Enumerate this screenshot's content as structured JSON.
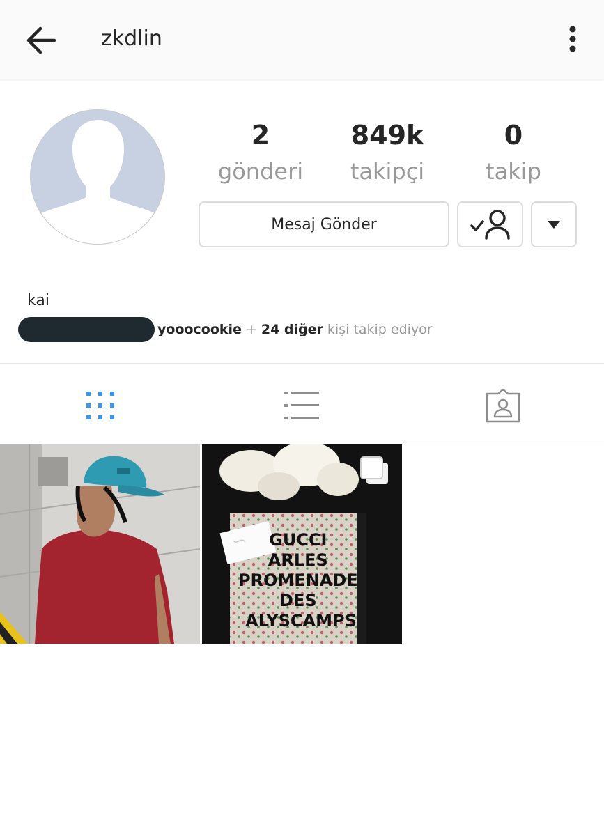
{
  "header": {
    "username": "zkdlin",
    "back_icon": "arrow-left-icon",
    "more_icon": "more-vertical-icon"
  },
  "stats": [
    {
      "value": "2",
      "label": "gönderi"
    },
    {
      "value": "849k",
      "label": "takipçi"
    },
    {
      "value": "0",
      "label": "takip"
    }
  ],
  "actions": {
    "message_label": "Mesaj Gönder",
    "following_icon": "user-check-icon",
    "dropdown_icon": "caret-down-icon"
  },
  "bio": {
    "name": "kai",
    "followed_by_user": "yooocookie",
    "followed_by_plus": "+",
    "followed_by_count": "24 diğer",
    "followed_by_rest": "kişi takip ediyor"
  },
  "tabs": [
    {
      "icon": "grid-icon",
      "active": true
    },
    {
      "icon": "list-icon",
      "active": false
    },
    {
      "icon": "tagged-icon",
      "active": false
    }
  ],
  "posts": [
    {
      "id": "post-1",
      "multi": false
    },
    {
      "id": "post-2",
      "multi": true,
      "caption_lines": [
        "GUCCI",
        "ARLES",
        "PROMENADE",
        "DES",
        "ALYSCAMPS"
      ]
    }
  ],
  "colors": {
    "accent": "#3897f0",
    "muted": "#999999",
    "text": "#262626"
  }
}
